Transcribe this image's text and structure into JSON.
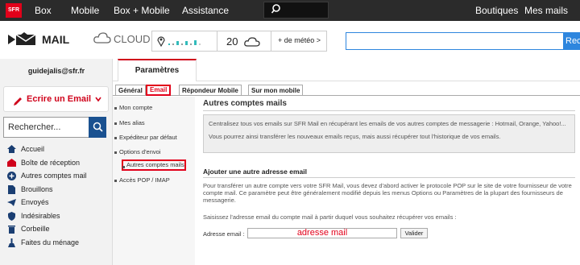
{
  "topbar": {
    "logo": "SFR",
    "nav": [
      "Box",
      "Mobile",
      "Box + Mobile",
      "Assistance"
    ],
    "right": [
      "Boutiques",
      "Mes mails"
    ],
    "separator": "·"
  },
  "header": {
    "mail_label": "MAIL",
    "cloud_label": "CLOUD",
    "weather": {
      "temperature": "20",
      "button": "+ de météo >"
    },
    "search_button": "Rec"
  },
  "sidebar": {
    "user": "guidejalis@sfr.fr",
    "write_button": "Ecrire un Email",
    "search_placeholder": "Rechercher...",
    "folders": [
      {
        "label": "Accueil",
        "icon": "home-icon"
      },
      {
        "label": "Boîte de réception",
        "icon": "inbox-icon"
      },
      {
        "label": "Autres comptes mail",
        "icon": "add-account-icon"
      },
      {
        "label": "Brouillons",
        "icon": "draft-icon"
      },
      {
        "label": "Envoyés",
        "icon": "sent-icon"
      },
      {
        "label": "Indésirables",
        "icon": "shield-icon"
      },
      {
        "label": "Corbeille",
        "icon": "trash-icon"
      },
      {
        "label": "Faites du ménage",
        "icon": "broom-icon"
      }
    ]
  },
  "tabs": {
    "main": "Paramètres"
  },
  "subtabs": [
    "Général",
    "Email",
    "Répondeur Mobile",
    "Sur mon mobile"
  ],
  "leftmenu": [
    "Mon compte",
    "Mes alias",
    "Expéditeur par défaut",
    "Options d'envoi",
    "Autres comptes mails",
    "Accès POP / IMAP"
  ],
  "content": {
    "title": "Autres comptes mails",
    "info1": "Centralisez tous vos emails sur SFR Mail en récupérant les emails de vos autres comptes de messagerie : Hotmail, Orange, Yahoo!...",
    "info2": "Vous pourrez ainsi transférer les nouveaux emails reçus, mais aussi récupérer tout l'historique de vos emails.",
    "add_title": "Ajouter une autre adresse email",
    "add_text": "Pour transférer un autre compte vers votre SFR Mail, vous devez d'abord activer le protocole POP sur le site de votre fournisseur de votre compte mail. Ce paramètre peut être généralement modifié depuis les menus Options ou Paramètres de la plupart des fournisseurs de messagerie.",
    "instruction": "Saisissez l'adresse email du compte mail à partir duquel vous souhaitez récupérer vos emails :",
    "address_label": "Adresse email :",
    "address_value": "adresse mail",
    "validate_button": "Valider"
  },
  "colors": {
    "accent": "#e2001a",
    "link_blue": "#2e86de",
    "search_btn": "#1a5190"
  }
}
